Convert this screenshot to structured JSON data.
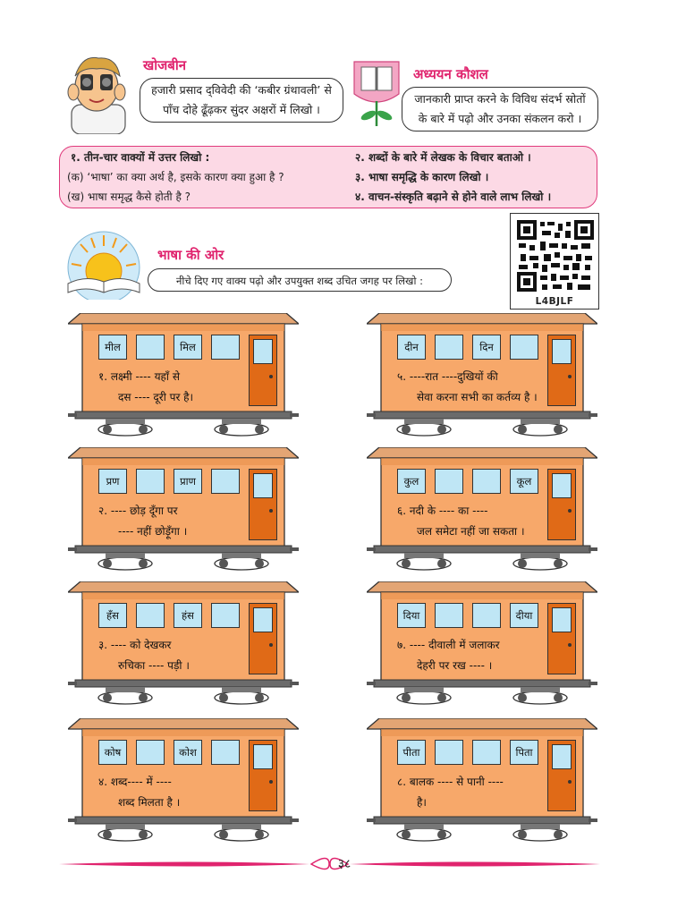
{
  "khojbeen": {
    "heading": "खोजबीन",
    "text_line1": "हजारी प्रसाद द्‌विवेदी की ‘कबीर ग्रंथावली’ से",
    "text_line2": "पाँच दोहे ढूँढ़कर सुंदर अक्षरों में लिखो ।"
  },
  "adhyayan": {
    "heading": "अध्ययन कौशल",
    "text_line1": "जानकारी प्राप्त करने के विविध संदर्भ स्रोतों",
    "text_line2": "के बारे में पढ़ो और उनका संकलन करो ।"
  },
  "questions": {
    "q1_title": "१.  तीन-चार वाक्यों में उत्तर लिखो :",
    "q1_a": "(क) ‘भाषा’ का क्या अर्थ है, इसके कारण क्या हुआ है ?",
    "q1_b": "(ख) भाषा समृद्ध कैसे होती है ?",
    "q2": "२. शब्दों के बारे में लेखक के विचार बताओ ।",
    "q3": "३. भाषा समृद्धि के कारण लिखो ।",
    "q4": "४. वाचन-संस्कृति बढ़ाने से होने वाले लाभ लिखो ।"
  },
  "qr": {
    "label": "L4BJLF"
  },
  "bhasha": {
    "heading": "भाषा की ओर",
    "instruction": "नीचे दिए गए वाक्य पढ़ो और उपयुक्त शब्द उचित जगह पर लिखो :"
  },
  "coaches": [
    {
      "word1": "मील",
      "word2": "मिल",
      "line1": "१. लक्ष्मी ---- यहाँ से",
      "line2": "दस ---- दूरी पर है।"
    },
    {
      "word1": "दीन",
      "word2": "दिन",
      "line1": "५. ----रात ----दुखियों की",
      "line2": "सेवा करना सभी का कर्तव्य है ।"
    },
    {
      "word1": "प्रण",
      "word2": "प्राण",
      "line1": "२. ---- छोड़ दूँगा पर",
      "line2": "---- नहीं छोड़ूँगा ।"
    },
    {
      "word1": "कुल",
      "word2": "कूल",
      "line1": "६. नदी के ---- का ----",
      "line2": "जल समेटा नहीं जा सकता ।"
    },
    {
      "word1": "हँस",
      "word2": "हंस",
      "line1": "३. ---- को देखकर",
      "line2": "रुचिका ---- पड़ी ।"
    },
    {
      "word1": "दिया",
      "word2": "दीया",
      "line1": "७. ---- दीवाली में जलाकर",
      "line2": "देहरी पर रख ---- ।"
    },
    {
      "word1": "कोष",
      "word2": "कोश",
      "line1": "४. शब्द---- में ----",
      "line2": "शब्द मिलता है ।"
    },
    {
      "word1": "पीता",
      "word2": "पिता",
      "line1": "८. बालक ---- से पानी ----",
      "line2": "है।"
    }
  ],
  "page_number": "३८",
  "colors": {
    "pink": "#e0246e",
    "coach": "#f7a86a",
    "roof": "#e3a574",
    "door": "#e06a17",
    "window": "#bfe6f5"
  }
}
